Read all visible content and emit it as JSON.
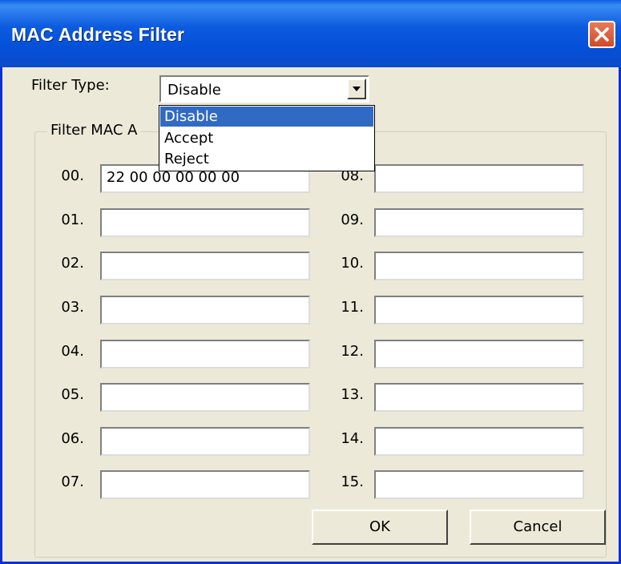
{
  "window": {
    "title": "MAC Address Filter"
  },
  "filter_type": {
    "label": "Filter Type:",
    "selected": "Disable",
    "options": [
      "Disable",
      "Accept",
      "Reject"
    ]
  },
  "group": {
    "legend": "Filter MAC A"
  },
  "left_column": [
    {
      "label": "00.",
      "value": "22 00 00 00 00 00"
    },
    {
      "label": "01.",
      "value": ""
    },
    {
      "label": "02.",
      "value": ""
    },
    {
      "label": "03.",
      "value": ""
    },
    {
      "label": "04.",
      "value": ""
    },
    {
      "label": "05.",
      "value": ""
    },
    {
      "label": "06.",
      "value": ""
    },
    {
      "label": "07.",
      "value": ""
    }
  ],
  "right_column": [
    {
      "label": "08.",
      "value": ""
    },
    {
      "label": "09.",
      "value": ""
    },
    {
      "label": "10.",
      "value": ""
    },
    {
      "label": "11.",
      "value": ""
    },
    {
      "label": "12.",
      "value": ""
    },
    {
      "label": "13.",
      "value": ""
    },
    {
      "label": "14.",
      "value": ""
    },
    {
      "label": "15.",
      "value": ""
    }
  ],
  "buttons": {
    "ok": "OK",
    "cancel": "Cancel"
  },
  "icons": {
    "close": "close-icon",
    "dropdown": "chevron-down-icon"
  },
  "colors": {
    "titlebar": "#0550d8",
    "selection": "#316ac5",
    "close_button": "#d14a28",
    "dialog_bg": "#ece9d8"
  }
}
